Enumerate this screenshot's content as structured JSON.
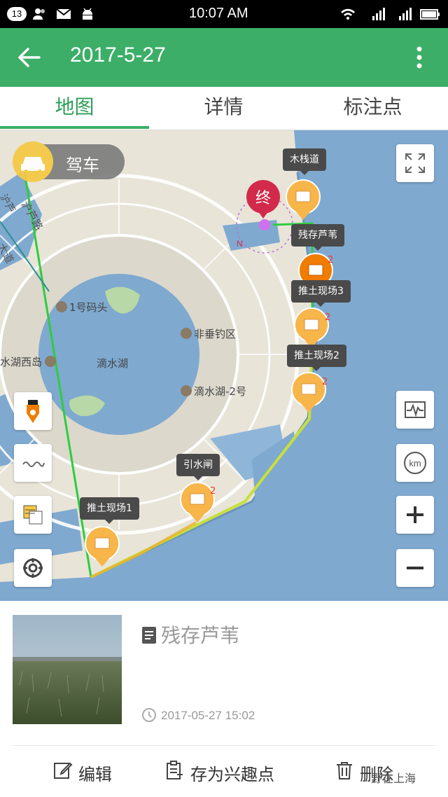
{
  "status_bar": {
    "notification_count": "13",
    "time": "10:07 AM"
  },
  "app_bar": {
    "title": "2017-5-27"
  },
  "tabs": [
    {
      "label": "地图",
      "active": true
    },
    {
      "label": "详情",
      "active": false
    },
    {
      "label": "标注点",
      "active": false
    }
  ],
  "map": {
    "drive_mode": "驾车",
    "end_marker": "终",
    "compass_letter": "N",
    "road_labels": [
      "沪芦路",
      "大道",
      "沪芦"
    ],
    "place_labels": {
      "pier": "1号码头",
      "fishing": "非垂钓区",
      "west_island": "水湖西岛",
      "lake": "滴水湖",
      "lake2": "滴水湖-2号"
    },
    "poi_markers": [
      {
        "label": "木栈道",
        "count": ""
      },
      {
        "label": "残存芦苇",
        "count": "2"
      },
      {
        "label": "推土现场3",
        "count": "2"
      },
      {
        "label": "推土现场2",
        "count": "2"
      },
      {
        "label": "引水闸",
        "count": "2"
      },
      {
        "label": "推土现场1",
        "count": ""
      }
    ],
    "extra_count": "2"
  },
  "detail": {
    "title": "残存芦苇",
    "timestamp": "2017-05-27 15:02"
  },
  "actions": {
    "edit": "编辑",
    "save_poi": "存为兴趣点",
    "delete": "删除"
  },
  "watermark": "野在上海",
  "colors": {
    "accent": "#3cae67",
    "water": "#7fa9cf",
    "land": "#e8e4d8",
    "marker": "#f7b54a",
    "marker_active": "#f07c00",
    "end_marker": "#d22a4a"
  }
}
